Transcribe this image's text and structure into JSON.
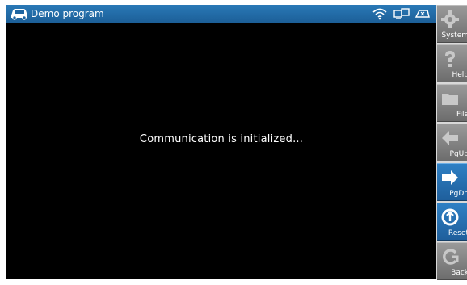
{
  "title_bar": {
    "title": "Demo program",
    "icons": [
      "car-icon",
      "wifi-icon",
      "pc-link-icon",
      "vci-link-icon"
    ]
  },
  "screen": {
    "message": "Communication is initialized..."
  },
  "side_buttons": [
    {
      "name": "system",
      "label": "System",
      "icon": "gear-icon",
      "active": false
    },
    {
      "name": "help",
      "label": "Help",
      "icon": "question-icon",
      "active": false
    },
    {
      "name": "file",
      "label": "File",
      "icon": "folder-icon",
      "active": false
    },
    {
      "name": "pgup",
      "label": "PgUp",
      "icon": "arrow-left-icon",
      "active": false
    },
    {
      "name": "pgdn",
      "label": "PgDn",
      "icon": "arrow-right-icon",
      "active": true
    },
    {
      "name": "reset",
      "label": "Reset",
      "icon": "reset-icon",
      "active": true
    },
    {
      "name": "back",
      "label": "Back",
      "icon": "back-icon",
      "active": false
    }
  ],
  "colors": {
    "titlebar": "#1f65a1",
    "active_button": "#2a73b3",
    "inactive_button": "#878787",
    "screen_bg": "#000000"
  }
}
